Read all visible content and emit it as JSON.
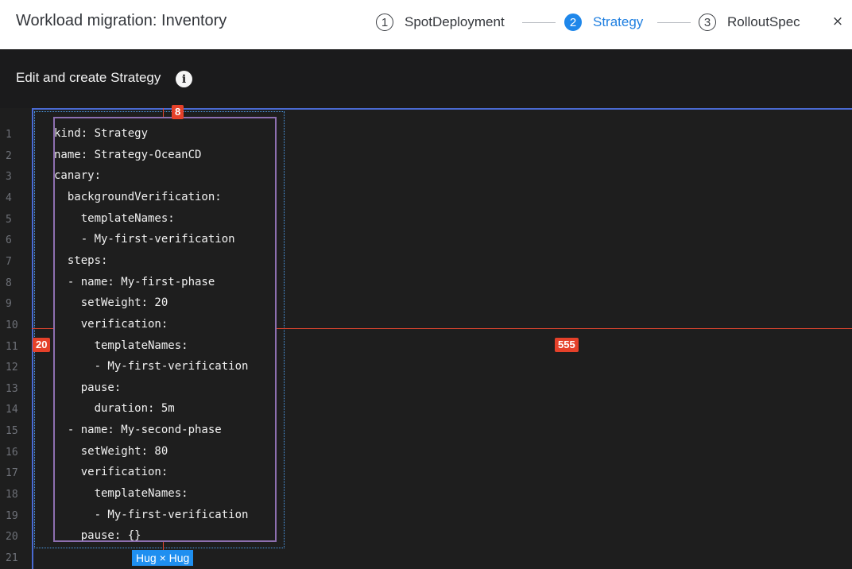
{
  "header": {
    "title": "Workload migration: Inventory",
    "steps": [
      {
        "number": "1",
        "label": "SpotDeployment",
        "active": false
      },
      {
        "number": "2",
        "label": "Strategy",
        "active": true
      },
      {
        "number": "3",
        "label": "RolloutSpec",
        "active": false
      }
    ],
    "close_label": "×"
  },
  "subheader": {
    "title": "Edit and create Strategy",
    "info_icon": "info-icon",
    "info_glyph": "i"
  },
  "editor": {
    "line_numbers": [
      "1",
      "2",
      "3",
      "4",
      "5",
      "6",
      "7",
      "8",
      "9",
      "10",
      "11",
      "12",
      "13",
      "14",
      "15",
      "16",
      "17",
      "18",
      "19",
      "20",
      "21"
    ],
    "lines": [
      "kind: Strategy",
      "name: Strategy-OceanCD",
      "canary:",
      "  backgroundVerification:",
      "    templateNames:",
      "    - My-first-verification",
      "  steps:",
      "  - name: My-first-phase",
      "    setWeight: 20",
      "    verification:",
      "      templateNames:",
      "      - My-first-verification",
      "    pause:",
      "      duration: 5m",
      "  - name: My-second-phase",
      "    setWeight: 80",
      "    verification:",
      "      templateNames:",
      "      - My-first-verification",
      "    pause: {}"
    ]
  },
  "overlay": {
    "top_spacing": "8",
    "left_spacing": "20",
    "right_spacing": "555",
    "sizing": "Hug × Hug"
  },
  "colors": {
    "accent": "#1f87ea",
    "measure": "#e5412a",
    "editor_bg": "#1e1e1e"
  }
}
